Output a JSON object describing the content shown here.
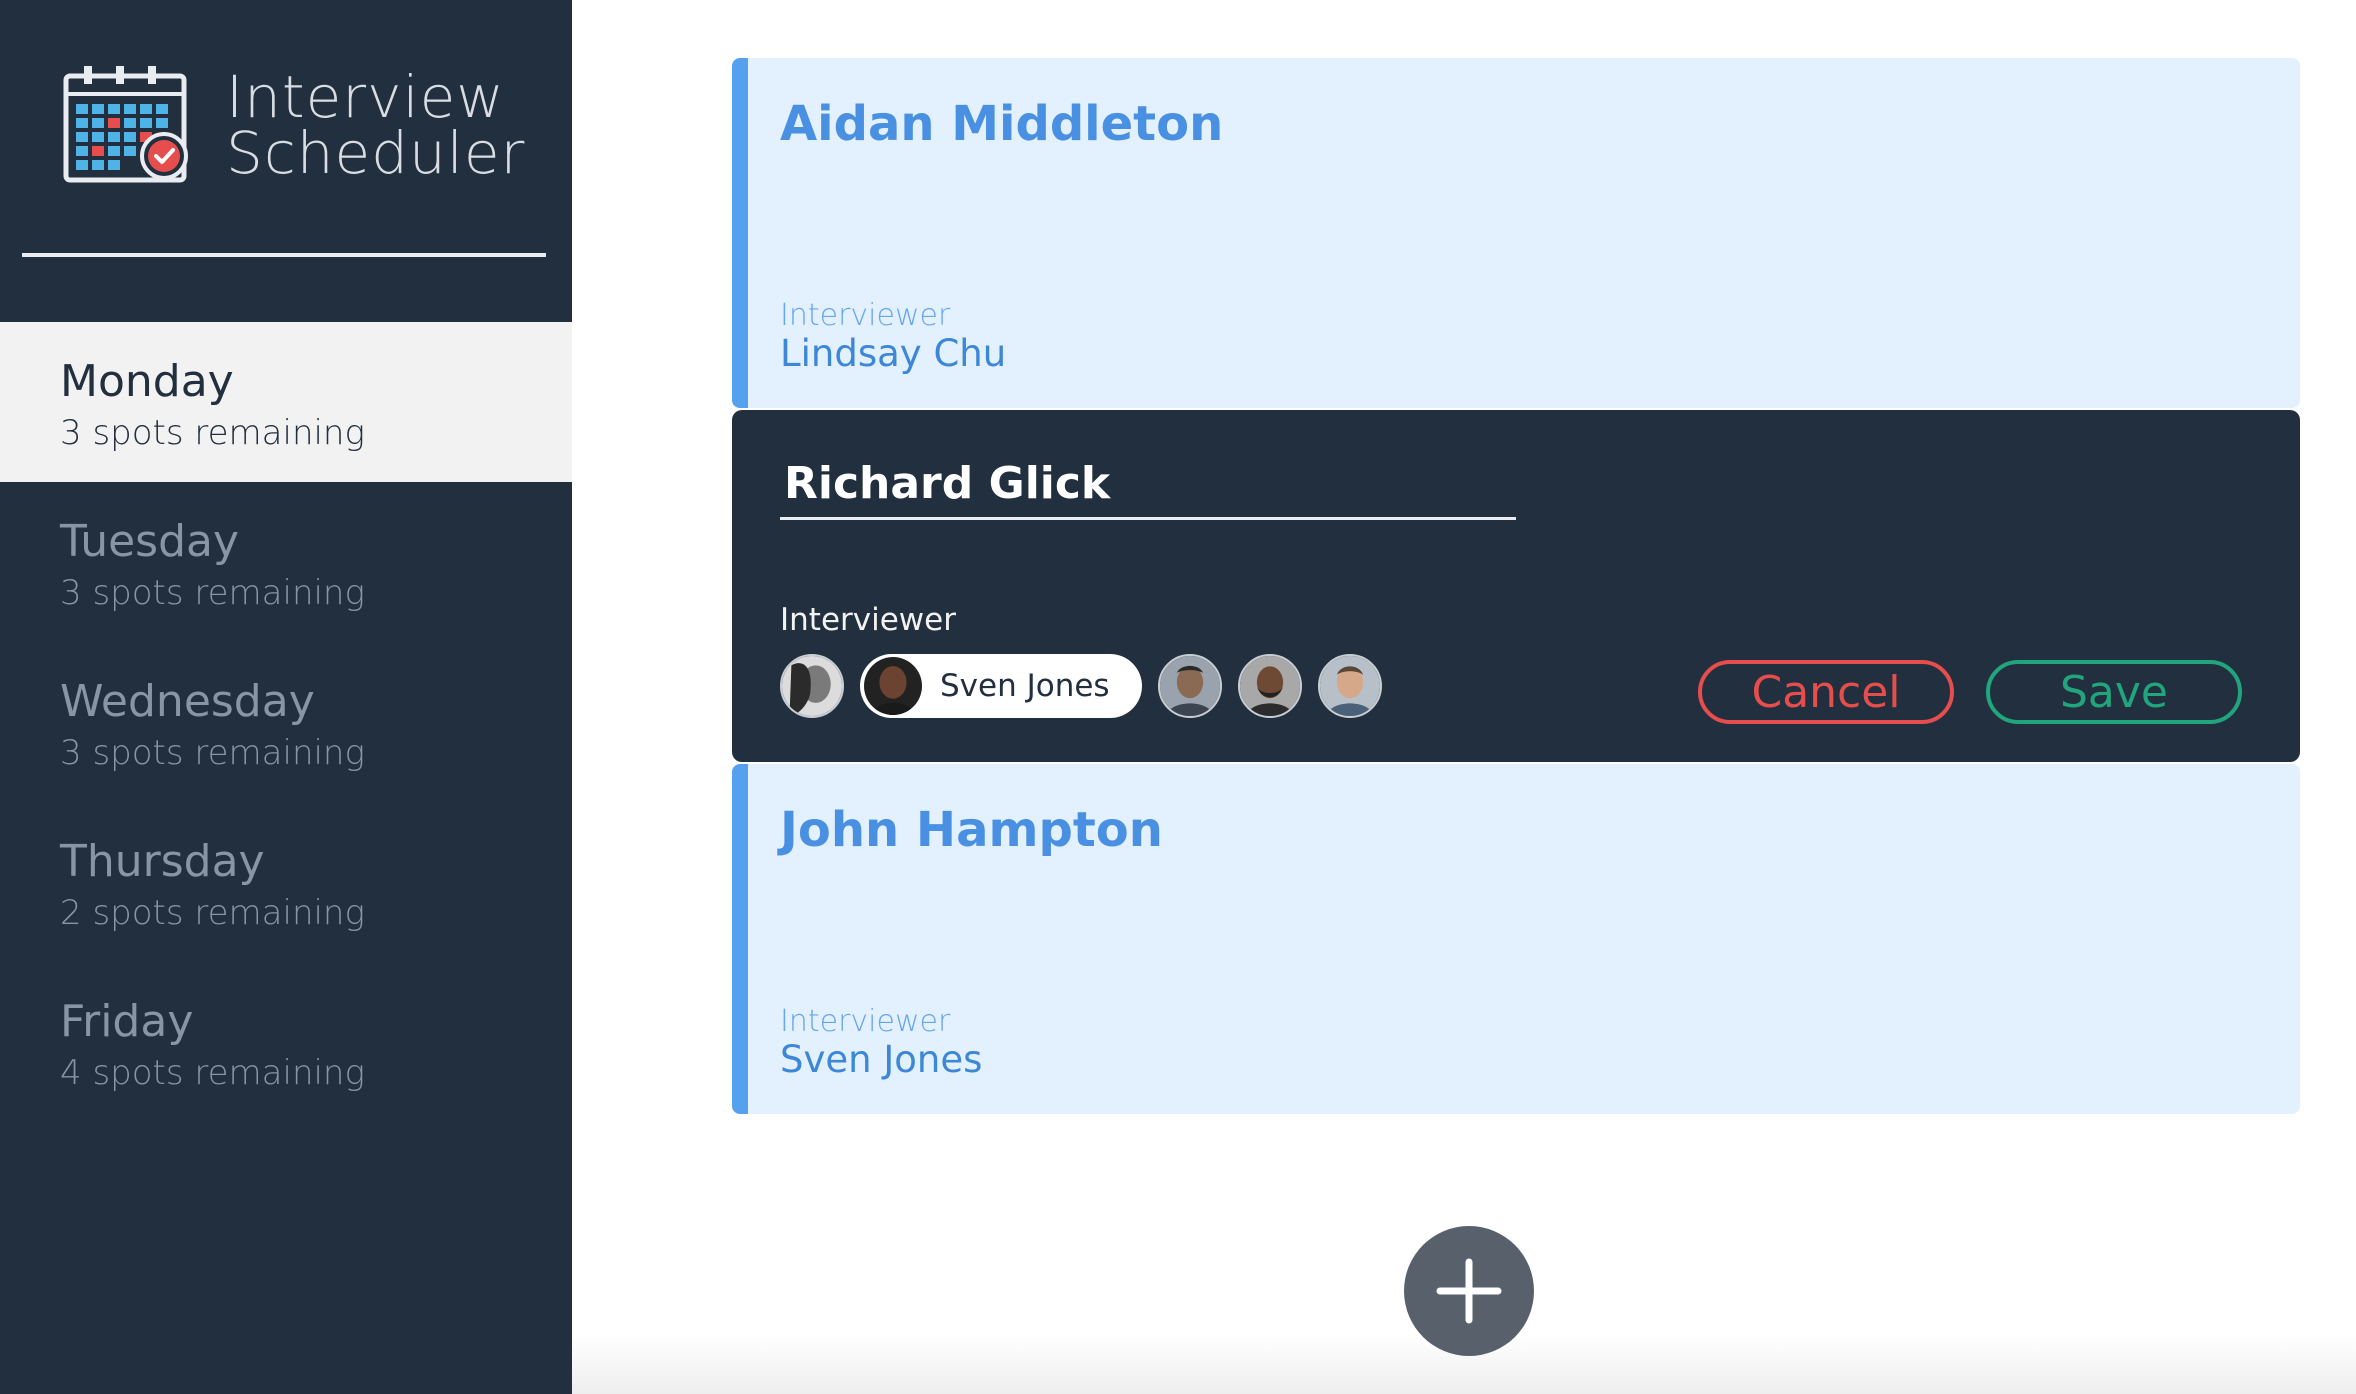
{
  "app": {
    "title_line1": "Interview",
    "title_line2": "Scheduler",
    "logo_icon": "calendar-check-icon"
  },
  "sidebar": {
    "days": [
      {
        "name": "Monday",
        "spots": "3 spots remaining",
        "selected": true
      },
      {
        "name": "Tuesday",
        "spots": "3 spots remaining",
        "selected": false
      },
      {
        "name": "Wednesday",
        "spots": "3 spots remaining",
        "selected": false
      },
      {
        "name": "Thursday",
        "spots": "2 spots remaining",
        "selected": false
      },
      {
        "name": "Friday",
        "spots": "4 spots remaining",
        "selected": false
      }
    ]
  },
  "appointments": [
    {
      "student": "Aidan Middleton",
      "interviewer_label": "Interviewer",
      "interviewer": "Lindsay Chu"
    },
    {
      "student": "John Hampton",
      "interviewer_label": "Interviewer",
      "interviewer": "Sven Jones"
    }
  ],
  "form": {
    "student_value": "Richard Glick",
    "interviewer_label": "Interviewer",
    "selected_interviewer": "Sven Jones",
    "cancel_label": "Cancel",
    "save_label": "Save"
  },
  "add_icon": "plus-icon",
  "colors": {
    "sidebar_bg": "#222f3e",
    "card_bg": "#e3f0fd",
    "card_accent": "#55a0ef",
    "cancel": "#e64d4d",
    "save": "#21a57c",
    "add_button": "#57606b"
  }
}
